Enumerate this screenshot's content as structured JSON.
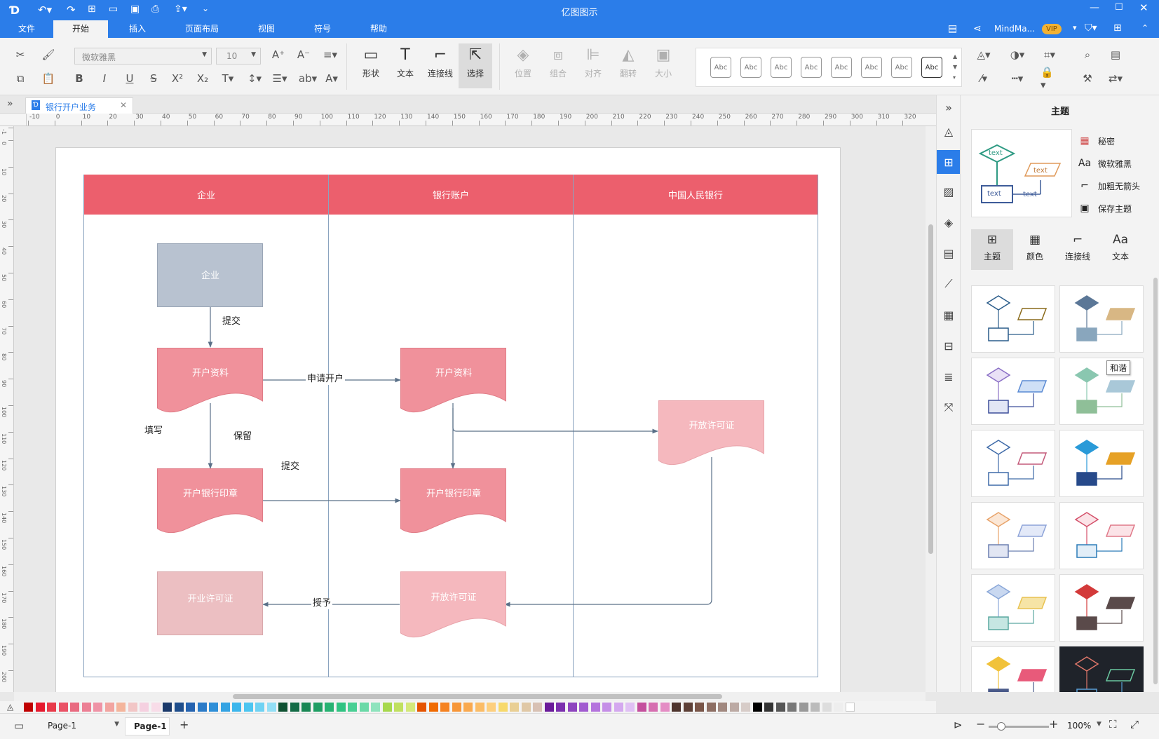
{
  "app": {
    "title": "亿图图示"
  },
  "menu": {
    "file": "文件",
    "start": "开始",
    "insert": "插入",
    "layout": "页面布局",
    "view": "视图",
    "symbol": "符号",
    "help": "帮助"
  },
  "account": {
    "name": "MindMa...",
    "vip": "VIP"
  },
  "ribbon": {
    "font_family": "微软雅黑",
    "font_size": "10",
    "shape": "形状",
    "text": "文本",
    "connector": "连接线",
    "select": "选择",
    "position": "位置",
    "group": "组合",
    "align": "对齐",
    "flip": "翻转",
    "size": "大小",
    "style_sample": "Abc",
    "ab_label": "ab"
  },
  "doc_tab": {
    "label": "银行开户业务"
  },
  "ruler": {
    "h_ticks": [
      "-10",
      "0",
      "10",
      "20",
      "30",
      "40",
      "50",
      "60",
      "70",
      "80",
      "90",
      "100",
      "110",
      "120",
      "130",
      "140",
      "150",
      "160",
      "170",
      "180",
      "190",
      "200",
      "210",
      "220",
      "230",
      "240",
      "250",
      "260",
      "270",
      "280",
      "290",
      "300",
      "310",
      "320"
    ],
    "v_ticks": [
      "-1",
      "0",
      "10",
      "20",
      "30",
      "40",
      "50",
      "60",
      "70",
      "80",
      "90",
      "100",
      "110",
      "120",
      "130",
      "140",
      "150",
      "160",
      "170",
      "180",
      "190",
      "200"
    ]
  },
  "diagram": {
    "lanes": [
      "企业",
      "银行账户",
      "中国人民银行"
    ],
    "shapes": {
      "enterprise": "企业",
      "docs_left": "开户资料",
      "docs_mid": "开户资料",
      "permit_right": "开放许可证",
      "seal_left": "开户银行印章",
      "seal_mid": "开户银行印章",
      "license_left": "开业许可证",
      "permit_mid": "开放许可证"
    },
    "labels": {
      "submit_1": "提交",
      "apply": "申请开户",
      "fill": "填写",
      "keep": "保留",
      "submit_2": "提交",
      "grant": "授予"
    },
    "colors": {
      "lane_header": "#ec5f6d",
      "enterprise_fill": "#b8c2d0",
      "doc_fill": "#f0919b",
      "permit_fill": "#f5b8be",
      "license_fill": "#ecbfc2",
      "edge": "#5a7088"
    }
  },
  "right_panel": {
    "title": "主题",
    "props": [
      "秘密",
      "微软雅黑",
      "加粗无箭头",
      "保存主题"
    ],
    "tabs": [
      "主题",
      "颜色",
      "连接线",
      "文本"
    ],
    "preview_text": "text",
    "tooltip": "和谐"
  },
  "status": {
    "page_select": "Page-1",
    "page_tab": "Page-1",
    "zoom": "100%"
  }
}
